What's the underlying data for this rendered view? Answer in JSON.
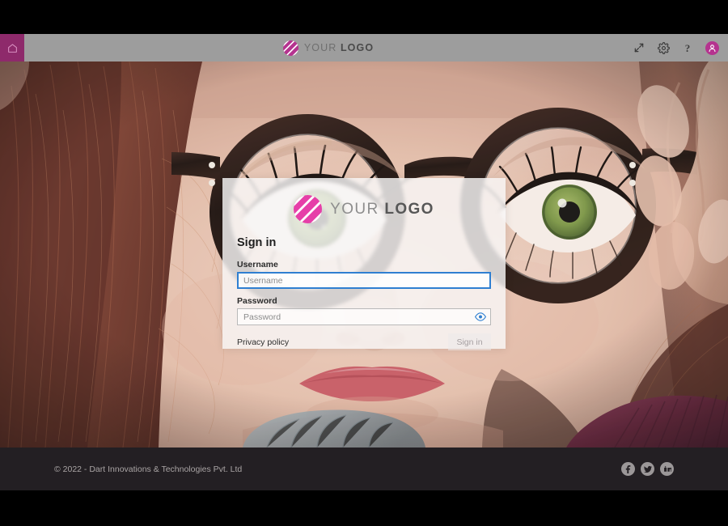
{
  "window": {
    "background_color": "#000000"
  },
  "header": {
    "background_color": "#9d9d9d",
    "home_tile_color": "#8e2a6b",
    "home_icon": "home-icon",
    "brand": {
      "mark_icon": "striped-circle-logo-mark",
      "mark_color": "#b5338f",
      "word_primary": "YOUR",
      "word_secondary": "LOGO"
    },
    "actions": [
      {
        "name": "fullscreen-icon",
        "label": "Fullscreen"
      },
      {
        "name": "gear-icon",
        "label": "Settings"
      },
      {
        "name": "help-icon",
        "label": "?"
      },
      {
        "name": "avatar",
        "label": "Account"
      }
    ],
    "help_glyph": "?",
    "avatar_color": "#b5338f"
  },
  "background": {
    "description": "Close-up portrait of a woman with green eyes wearing large round tortoiseshell glasses, auburn hair, burgundy ribbed sweater",
    "hair_color": "#7a3f36",
    "skin_color": "#e6c3b4",
    "eye_color": "#7f9b4e",
    "frame_color": "#2a1a16",
    "sweater_color": "#7a2e4e",
    "lip_color": "#d4616b"
  },
  "login_card": {
    "background_color": "#f8f6f6",
    "brand": {
      "mark_icon": "striped-circle-logo-mark",
      "mark_color": "#e63fa8",
      "word_primary": "YOUR",
      "word_secondary": "LOGO"
    },
    "title": "Sign in",
    "username": {
      "label": "Username",
      "placeholder": "Username",
      "value": "",
      "focused": true,
      "focus_border_color": "#2f7fd1"
    },
    "password": {
      "label": "Password",
      "placeholder": "Password",
      "value": "",
      "reveal_icon": "eye-icon",
      "reveal_icon_color": "#2f7fd1"
    },
    "privacy_link": "Privacy policy",
    "submit": {
      "label": "Sign in",
      "disabled": true
    }
  },
  "footer": {
    "background_color": "#231f23",
    "copyright": "© 2022 - Dart Innovations & Technologies Pvt. Ltd",
    "social": [
      {
        "name": "facebook-icon",
        "label": "Facebook"
      },
      {
        "name": "twitter-icon",
        "label": "Twitter"
      },
      {
        "name": "linkedin-icon",
        "label": "LinkedIn"
      }
    ],
    "social_color": "#9b9798"
  }
}
